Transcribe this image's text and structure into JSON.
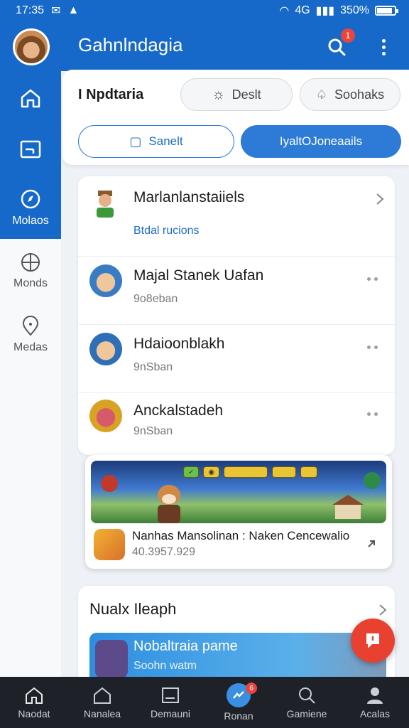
{
  "status": {
    "time": "17:35",
    "network": "4G",
    "battery": "350%"
  },
  "header": {
    "title": "Gahnlndagia",
    "notif_count": "1"
  },
  "rail": [
    {
      "label": "",
      "icon": "home-icon"
    },
    {
      "label": "",
      "icon": "wallet-icon"
    },
    {
      "label": "Molaos",
      "icon": "compass-icon"
    },
    {
      "label": "Monds",
      "icon": "globe-icon"
    },
    {
      "label": "Medas",
      "icon": "location-pin-icon"
    }
  ],
  "panel": {
    "title": "I Npdtaria",
    "chip_left": "Deslt",
    "chip_right": "Soohaks",
    "seg_left": "Sanelt",
    "seg_right": "IyaltOJoneaails"
  },
  "list": {
    "header_title": "Marlanlanstaiiels",
    "header_link": "Btdal rucions",
    "rows": [
      {
        "name": "Majal Stanek Uafan",
        "sub": "9o8eban"
      },
      {
        "name": "Hdaioonblakh",
        "sub": "9nSban"
      },
      {
        "name": "Anckalstadeh",
        "sub": "9nSban"
      }
    ]
  },
  "game": {
    "title": "Nanhas Mansolinan : Naken Cencewalio",
    "sub": "40.3957.929"
  },
  "section": {
    "title": "Nualx Ileaph",
    "promo_title": "Nobaltraia pame",
    "promo_sub": "Soohn watm"
  },
  "bottom_nav": [
    {
      "label": "Naodat",
      "icon": "home-icon"
    },
    {
      "label": "Nanalea",
      "icon": "house-outline-icon"
    },
    {
      "label": "Demauni",
      "icon": "gallery-icon"
    },
    {
      "label": "Ronan",
      "icon": "messenger-icon",
      "badge": "6"
    },
    {
      "label": "Gamiene",
      "icon": "search-icon"
    },
    {
      "label": "Acalas",
      "icon": "person-icon"
    }
  ],
  "colors": {
    "primary": "#1769c9",
    "accent": "#2d7bd6",
    "fab": "#e8412f",
    "nav_bg": "#1e2228"
  }
}
